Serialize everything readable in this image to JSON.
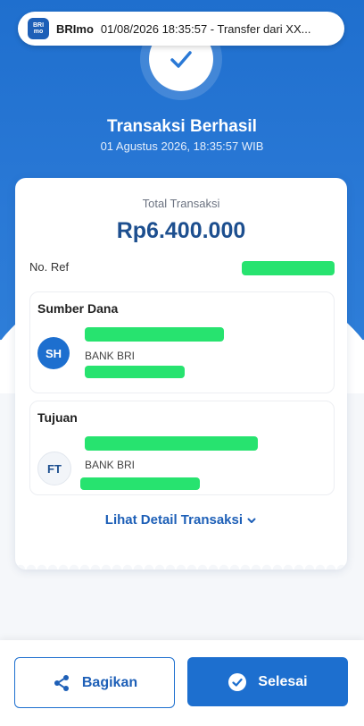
{
  "notification": {
    "app_icon_text_top": "BRI",
    "app_icon_text_bottom": "mo",
    "app_name": "BRImo",
    "message": "01/08/2026 18:35:57 - Transfer dari XX..."
  },
  "header": {
    "title": "Transaksi Berhasil",
    "datetime": "01 Agustus 2026, 18:35:57 WIB"
  },
  "receipt": {
    "total_label": "Total Transaksi",
    "total_amount": "Rp6.400.000",
    "ref_label": "No. Ref",
    "source": {
      "title": "Sumber Dana",
      "initials": "SH",
      "bank": "BANK BRI"
    },
    "destination": {
      "title": "Tujuan",
      "initials": "FT",
      "bank": "BANK BRI"
    },
    "detail_link": "Lihat Detail Transaksi"
  },
  "actions": {
    "share_label": "Bagikan",
    "done_label": "Selesai"
  },
  "colors": {
    "primary_blue": "#1d6fcf",
    "redaction_green": "#27e36f"
  },
  "icons": [
    "check-icon",
    "share-icon",
    "check-circle-icon",
    "chevron-down-icon"
  ]
}
